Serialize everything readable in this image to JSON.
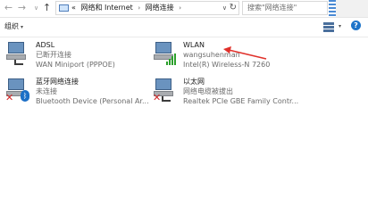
{
  "nav": {
    "back_icon": "arrow-left-icon",
    "forward_icon": "arrow-right-icon",
    "history_icon": "chevron-down-icon",
    "up_icon": "arrow-up-icon"
  },
  "address": {
    "lead": "«",
    "crumbs": [
      "网络和 Internet",
      "网络连接"
    ],
    "separator": "›",
    "dropdown_glyph": "∨",
    "refresh_glyph": "↻"
  },
  "search": {
    "placeholder": "搜索\"网络连接\""
  },
  "toolbar": {
    "organize_label": "组织",
    "organize_caret": "▾",
    "view_caret": "▾",
    "help_glyph": "?"
  },
  "connections": [
    {
      "name": "ADSL",
      "status": "已断开连接",
      "device": "WAN Miniport (PPPOE)"
    },
    {
      "name": "WLAN",
      "status": "wangsuhenman",
      "device": "Intel(R) Wireless-N 7260"
    },
    {
      "name": "蓝牙网络连接",
      "status": "未连接",
      "device": "Bluetooth Device (Personal Ar..."
    },
    {
      "name": "以太网",
      "status": "网络电缆被拔出",
      "device": "Realtek PCIe GBE Family Contr..."
    }
  ],
  "colors": {
    "annotation_arrow": "#e0312b",
    "wifi_signal": "#2ca02c",
    "error_x": "#d42a2a",
    "bluetooth": "#1c6fc6"
  }
}
